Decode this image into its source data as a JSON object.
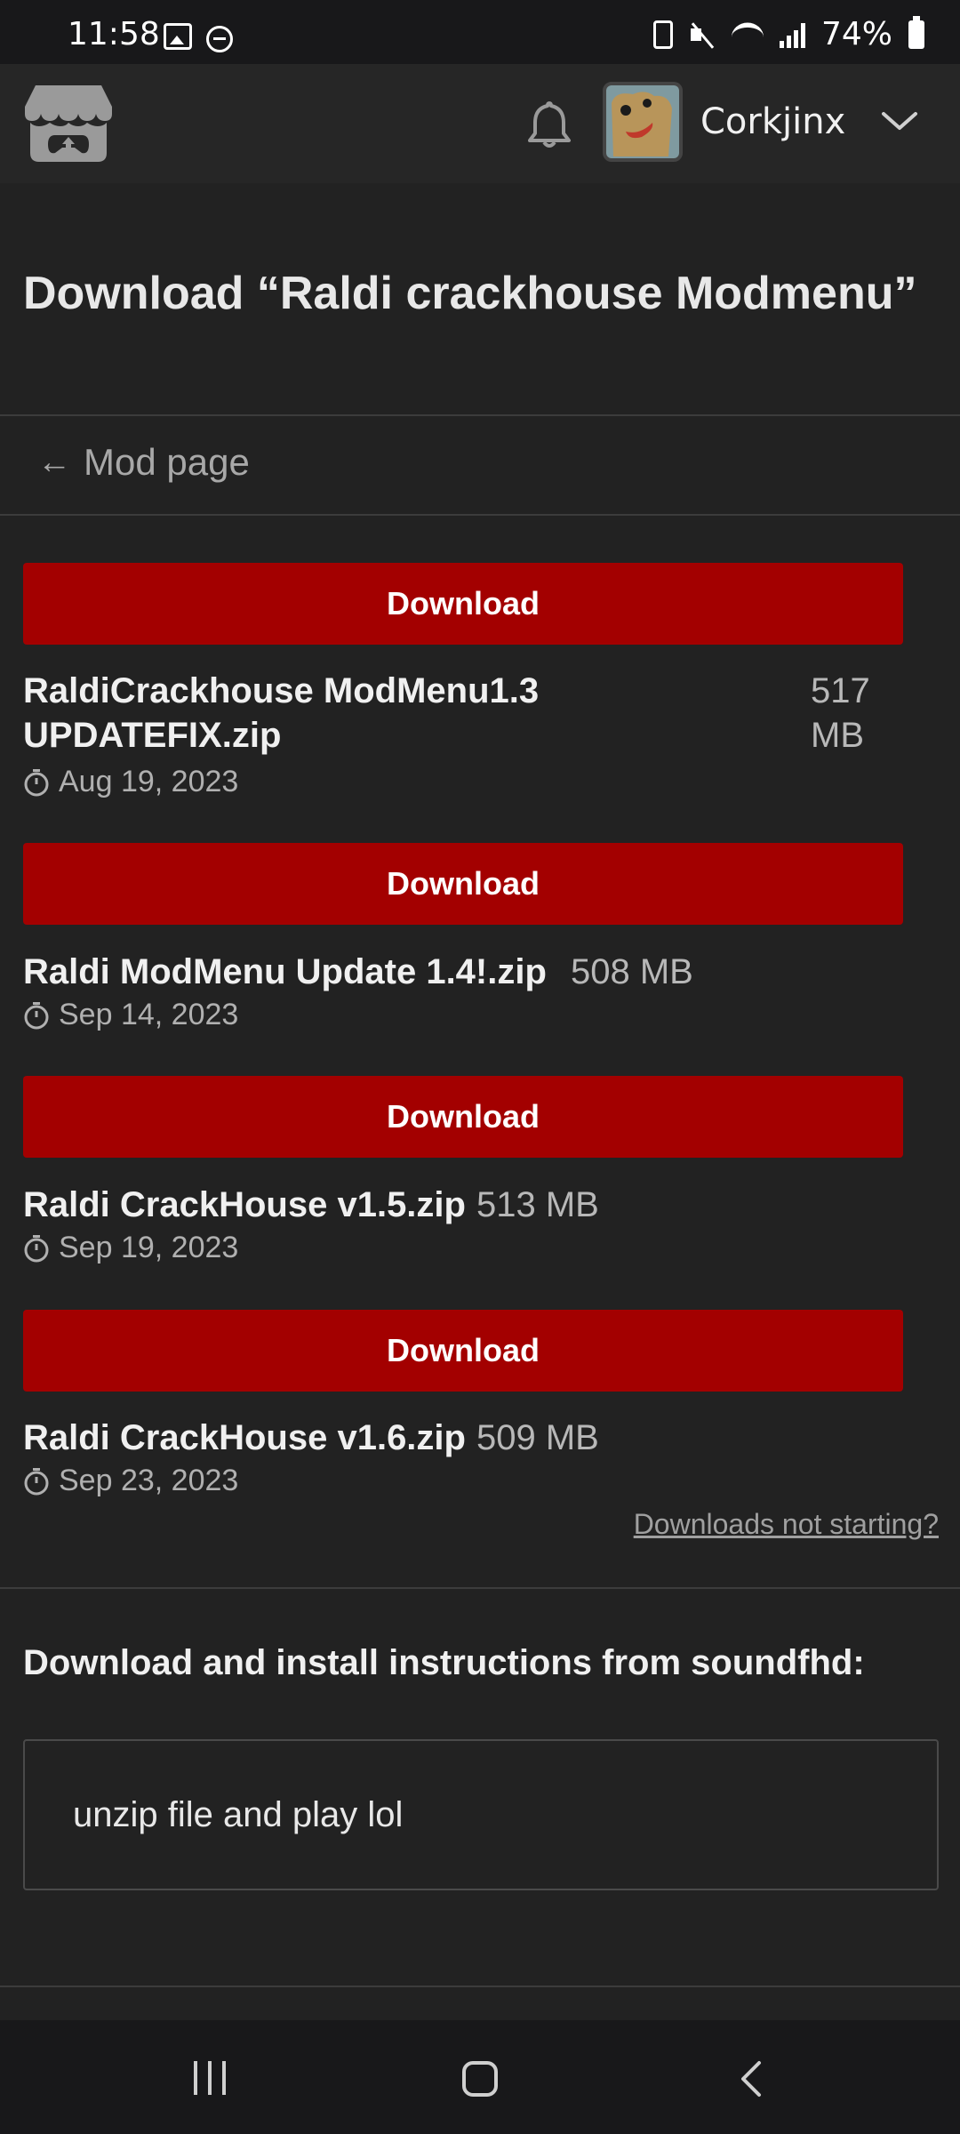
{
  "status_bar": {
    "time": "11:58",
    "battery": "74%"
  },
  "header": {
    "username": "Corkjinx"
  },
  "page": {
    "title": "Download “Raldi crackhouse Modmenu”",
    "back_link": "Mod page",
    "downloads_help": "Downloads not starting?"
  },
  "downloads": [
    {
      "button": "Download",
      "name_line1": "RaldiCrackhouse ModMenu1.3",
      "name_line2": "UPDATEFIX.zip",
      "size_line1": "517",
      "size_line2": "MB",
      "date": "Aug 19, 2023"
    },
    {
      "button": "Download",
      "name": "Raldi ModMenu Update 1.4!.zip",
      "size": "508 MB",
      "date": "Sep 14, 2023"
    },
    {
      "button": "Download",
      "name": "Raldi CrackHouse v1.5.zip",
      "size": "513 MB",
      "date": "Sep 19, 2023"
    },
    {
      "button": "Download",
      "name": "Raldi CrackHouse v1.6.zip",
      "size": "509 MB",
      "date": "Sep 23, 2023"
    }
  ],
  "instructions": {
    "title": "Download and install instructions from soundfhd:",
    "text": "unzip file and play lol"
  },
  "colors": {
    "download_button": "#a30000",
    "background": "#222222",
    "header": "#262626"
  }
}
